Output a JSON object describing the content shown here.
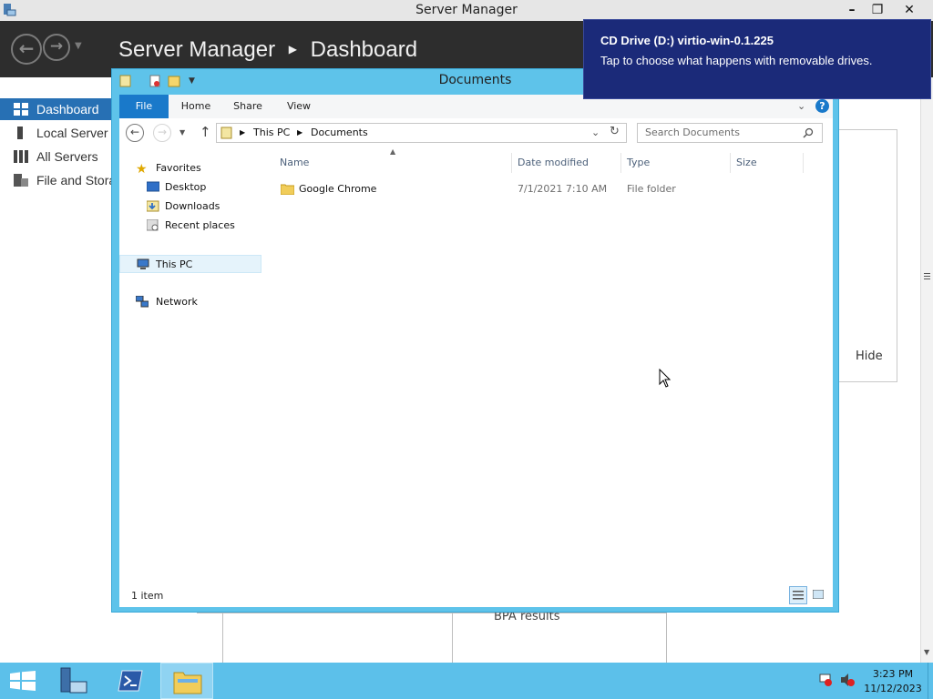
{
  "server_manager": {
    "window_title": "Server Manager",
    "header_title": "Server Manager",
    "header_page": "Dashboard",
    "sidebar": [
      {
        "label": "Dashboard",
        "icon": "dashboard-icon",
        "active": true
      },
      {
        "label": "Local Server",
        "icon": "server-icon",
        "active": false
      },
      {
        "label": "All Servers",
        "icon": "servers-icon",
        "active": false
      },
      {
        "label": "File and Storage Services",
        "icon": "storage-icon",
        "active": false
      }
    ],
    "hide_link": "Hide",
    "bpa_label": "BPA results"
  },
  "explorer": {
    "title": "Documents",
    "ribbon_tabs": [
      "File",
      "Home",
      "Share",
      "View"
    ],
    "breadcrumb": [
      "This PC",
      "Documents"
    ],
    "search_placeholder": "Search Documents",
    "nav_pane": {
      "favorites": "Favorites",
      "favorite_items": [
        "Desktop",
        "Downloads",
        "Recent places"
      ],
      "this_pc": "This PC",
      "network": "Network"
    },
    "columns": [
      "Name",
      "Date modified",
      "Type",
      "Size"
    ],
    "rows": [
      {
        "name": "Google Chrome",
        "date_modified": "7/1/2021 7:10 AM",
        "type": "File folder",
        "size": ""
      }
    ],
    "status": "1 item"
  },
  "toast": {
    "title": "CD Drive (D:) virtio-win-0.1.225",
    "message": "Tap to choose what happens with removable drives."
  },
  "taskbar": {
    "time": "3:23 PM",
    "date": "11/12/2023"
  },
  "colors": {
    "taskbar": "#5cc0ea",
    "toast": "#1b2a79",
    "sidebar_active": "#2770b4",
    "sm_header": "#2d2d2d"
  }
}
